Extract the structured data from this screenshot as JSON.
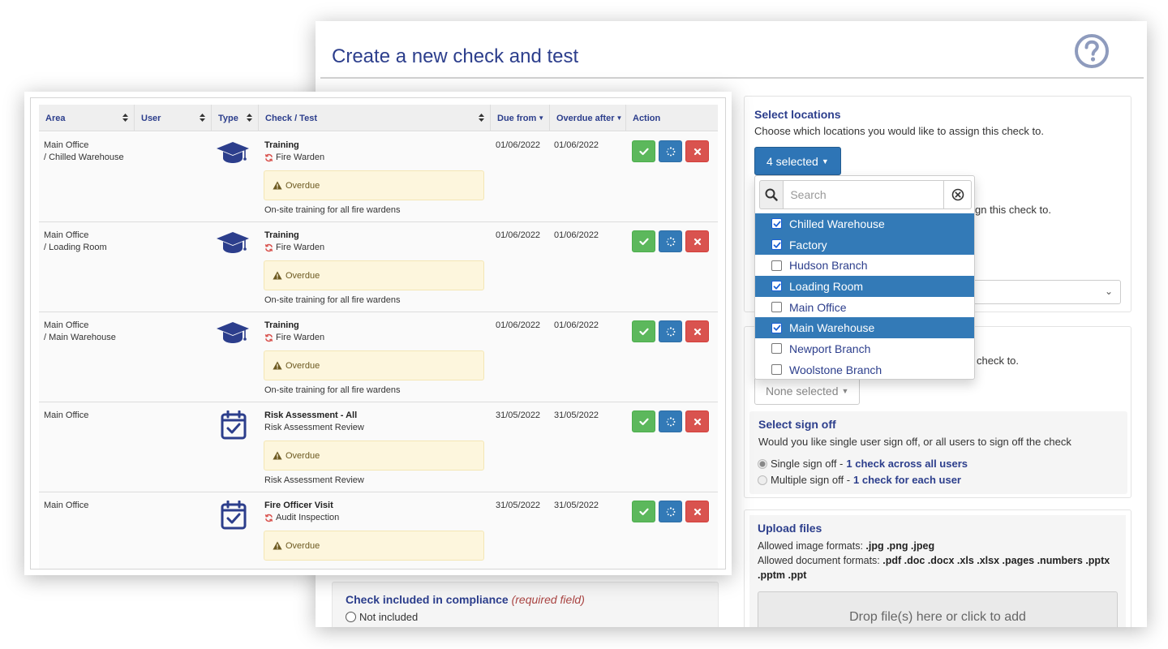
{
  "form": {
    "title": "Create a new check and test",
    "help_icon": "question-circle-icon"
  },
  "locations": {
    "heading": "Select locations",
    "description": "Choose which locations you would like to assign this check to.",
    "button_label": "4 selected",
    "hidden_text": "gn this check to."
  },
  "dropdown": {
    "search_placeholder": "Search",
    "items": [
      {
        "label": "Chilled Warehouse",
        "checked": true
      },
      {
        "label": "Factory",
        "checked": true
      },
      {
        "label": "Hudson Branch",
        "checked": false
      },
      {
        "label": "Loading Room",
        "checked": true
      },
      {
        "label": "Main Office",
        "checked": false
      },
      {
        "label": "Main Warehouse",
        "checked": true
      },
      {
        "label": "Newport Branch",
        "checked": false
      },
      {
        "label": "Woolstone Branch",
        "checked": false
      }
    ]
  },
  "users": {
    "hidden_text": "check to.",
    "button_label": "None selected"
  },
  "signoff": {
    "heading": "Select sign off",
    "description": "Would you like single user sign off, or all users to sign off the check",
    "single_label": "Single sign off - ",
    "single_strong": "1 check across all users",
    "multiple_label": "Multiple sign off - ",
    "multiple_strong": "1 check for each user"
  },
  "upload": {
    "heading": "Upload files",
    "image_label": "Allowed image formats: ",
    "image_formats": ".jpg .png .jpeg",
    "doc_label": "Allowed document formats: ",
    "doc_formats_1": ".pdf .doc .docx .xls .xlsx .pages .numbers .pptx",
    "doc_formats_2": ".pptm .ppt",
    "dropzone": "Drop file(s) here or click to add"
  },
  "compliance": {
    "heading": "Check included in compliance ",
    "required": "(required field)",
    "option": "Not included"
  },
  "table": {
    "headers": {
      "area": "Area",
      "user": "User",
      "type": "Type",
      "check": "Check / Test",
      "due": "Due from",
      "overdue": "Overdue after",
      "action": "Action"
    },
    "rows": [
      {
        "area1": "Main Office",
        "area2": "/ Chilled Warehouse",
        "type": "graduation-cap-icon",
        "title": "Training",
        "sub": "Fire Warden",
        "recurring": true,
        "due": "01/06/2022",
        "overdue_after": "01/06/2022",
        "status": "Overdue",
        "desc": "On-site training for all fire wardens"
      },
      {
        "area1": "Main Office",
        "area2": "/ Loading Room",
        "type": "graduation-cap-icon",
        "title": "Training",
        "sub": "Fire Warden",
        "recurring": true,
        "due": "01/06/2022",
        "overdue_after": "01/06/2022",
        "status": "Overdue",
        "desc": "On-site training for all fire wardens"
      },
      {
        "area1": "Main Office",
        "area2": "/ Main Warehouse",
        "type": "graduation-cap-icon",
        "title": "Training",
        "sub": "Fire Warden",
        "recurring": true,
        "due": "01/06/2022",
        "overdue_after": "01/06/2022",
        "status": "Overdue",
        "desc": "On-site training for all fire wardens"
      },
      {
        "area1": "Main Office",
        "area2": "",
        "type": "calendar-check-icon",
        "title": "Risk Assessment - All",
        "sub": "Risk Assessment Review",
        "recurring": false,
        "due": "31/05/2022",
        "overdue_after": "31/05/2022",
        "status": "Overdue",
        "desc": "Risk Assessment Review"
      },
      {
        "area1": "Main Office",
        "area2": "",
        "type": "calendar-check-icon",
        "title": "Fire Officer Visit",
        "sub": "Audit Inspection",
        "recurring": true,
        "due": "31/05/2022",
        "overdue_after": "31/05/2022",
        "status": "Overdue",
        "desc": ""
      }
    ]
  },
  "colors": {
    "brand_blue": "#2c3e8c",
    "primary": "#337ab7",
    "success": "#5cb85c",
    "danger": "#d9534f",
    "warning_bg": "#fdf6dd",
    "recurring_red": "#d9534f"
  }
}
